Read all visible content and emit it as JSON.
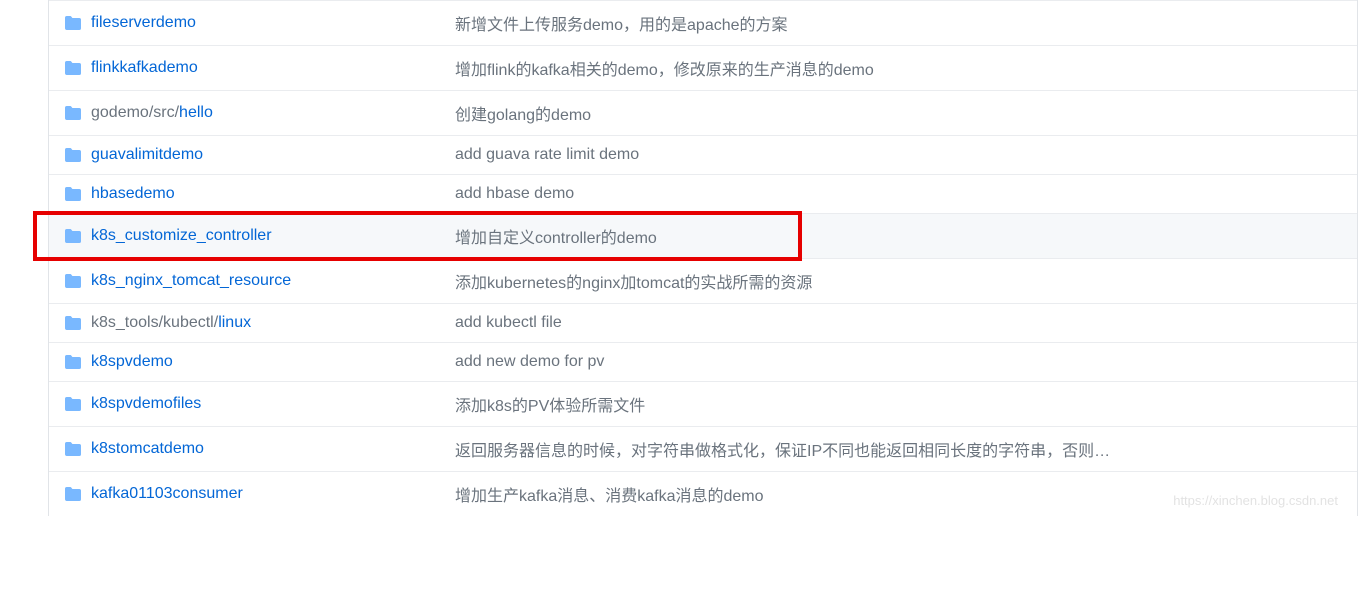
{
  "files": [
    {
      "name": "fileserverdemo",
      "path_prefix": "",
      "commit": "新增文件上传服务demo，用的是apache的方案",
      "highlighted": false
    },
    {
      "name": "flinkkafkademo",
      "path_prefix": "",
      "commit": "增加flink的kafka相关的demo，修改原来的生产消息的demo",
      "highlighted": false
    },
    {
      "name": "hello",
      "path_prefix": "godemo/src/",
      "commit": "创建golang的demo",
      "highlighted": false
    },
    {
      "name": "guavalimitdemo",
      "path_prefix": "",
      "commit": "add guava rate limit demo",
      "highlighted": false
    },
    {
      "name": "hbasedemo",
      "path_prefix": "",
      "commit": "add hbase demo",
      "highlighted": false
    },
    {
      "name": "k8s_customize_controller",
      "path_prefix": "",
      "commit": "增加自定义controller的demo",
      "highlighted": true
    },
    {
      "name": "k8s_nginx_tomcat_resource",
      "path_prefix": "",
      "commit": "添加kubernetes的nginx加tomcat的实战所需的资源",
      "highlighted": false
    },
    {
      "name": "linux",
      "path_prefix": "k8s_tools/kubectl/",
      "commit": "add kubectl file",
      "highlighted": false
    },
    {
      "name": "k8spvdemo",
      "path_prefix": "",
      "commit": "add new demo for pv",
      "highlighted": false
    },
    {
      "name": "k8spvdemofiles",
      "path_prefix": "",
      "commit": "添加k8s的PV体验所需文件",
      "highlighted": false
    },
    {
      "name": "k8stomcatdemo",
      "path_prefix": "",
      "commit": "返回服务器信息的时候，对字符串做格式化，保证IP不同也能返回相同长度的字符串，否则…",
      "highlighted": false
    },
    {
      "name": "kafka01103consumer",
      "path_prefix": "",
      "commit": "增加生产kafka消息、消费kafka消息的demo",
      "highlighted": false
    }
  ],
  "watermark": "https://xinchen.blog.csdn.net"
}
